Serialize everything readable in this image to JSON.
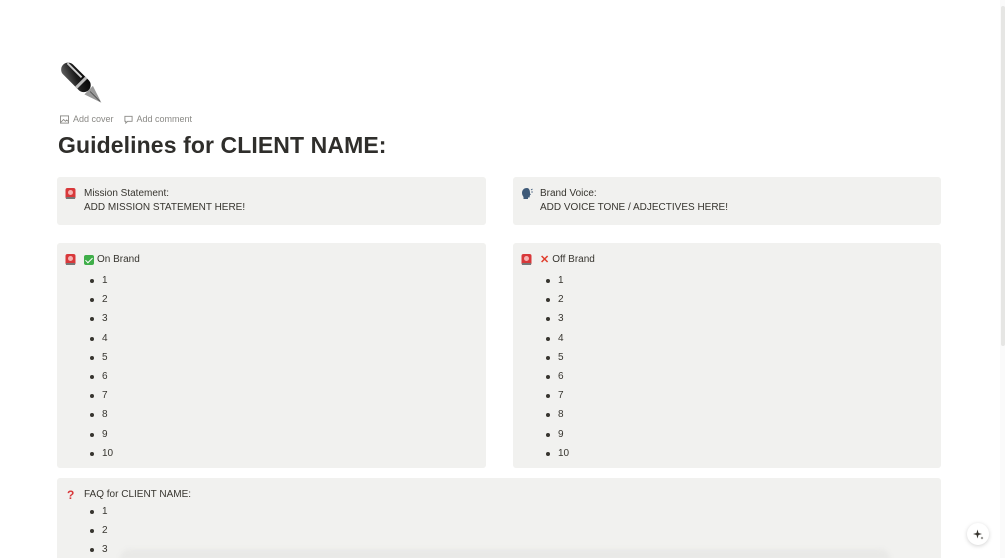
{
  "page": {
    "icon": "fountain-pen-icon",
    "add_cover": "Add cover",
    "add_comment": "Add comment",
    "title": "Guidelines for CLIENT NAME:"
  },
  "mission": {
    "icon": "siren-icon",
    "label": "Mission Statement:",
    "value": "ADD MISSION STATEMENT HERE!"
  },
  "voice": {
    "icon": "speaking-head-icon",
    "label": "Brand Voice:",
    "value": "ADD VOICE TONE / ADJECTIVES HERE!"
  },
  "on_brand": {
    "icon": "siren-icon",
    "marker": "check-mark-icon",
    "label": "On Brand",
    "items": [
      "1",
      "2",
      "3",
      "4",
      "5",
      "6",
      "7",
      "8",
      "9",
      "10"
    ]
  },
  "off_brand": {
    "icon": "siren-icon",
    "marker": "cross-mark-icon",
    "label": "Off Brand",
    "items": [
      "1",
      "2",
      "3",
      "4",
      "5",
      "6",
      "7",
      "8",
      "9",
      "10"
    ]
  },
  "faq": {
    "icon": "question-mark-icon",
    "label": "FAQ for CLIENT NAME:",
    "items": [
      "1",
      "2",
      "3"
    ]
  },
  "colors": {
    "callout_bg": "#f1f1ef",
    "text": "#37352f",
    "check": "#3fae49",
    "cross": "#e03e2d"
  },
  "floating": {
    "icon": "sparkle-icon"
  }
}
